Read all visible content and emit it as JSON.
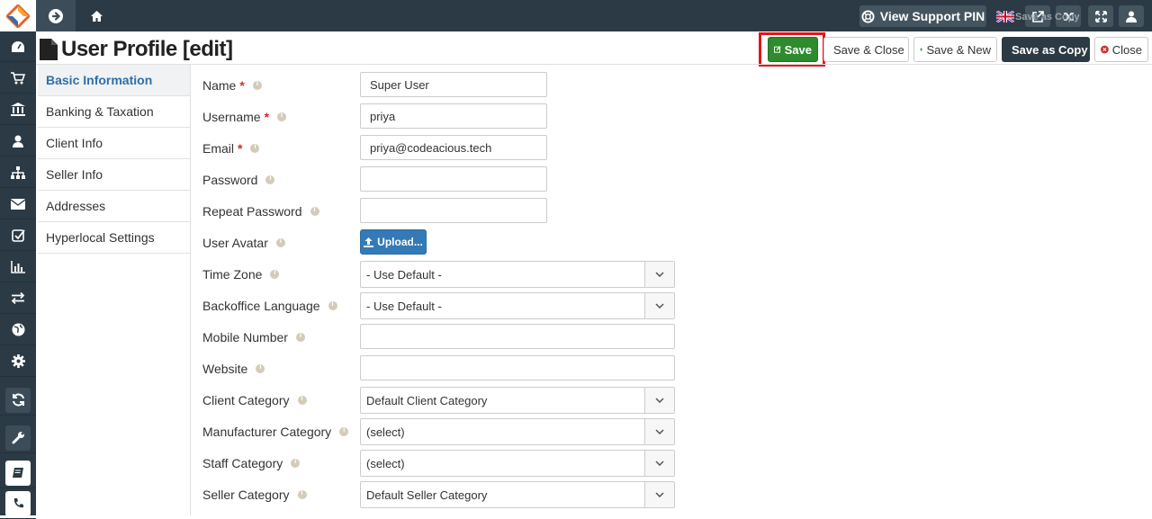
{
  "topbar": {
    "support_pin_label": "View Support PIN",
    "tooltip": "Save as Copy"
  },
  "page": {
    "title": "User Profile [edit]"
  },
  "toolbar": {
    "save_label": "Save",
    "save_close_label": "Save & Close",
    "save_new_label": "Save & New",
    "save_copy_label": "Save as Copy",
    "close_label": "Close"
  },
  "tabs": [
    {
      "label": "Basic Information"
    },
    {
      "label": "Banking & Taxation"
    },
    {
      "label": "Client Info"
    },
    {
      "label": "Seller Info"
    },
    {
      "label": "Addresses"
    },
    {
      "label": "Hyperlocal Settings"
    }
  ],
  "form": {
    "name": {
      "label": "Name",
      "value": "Super User"
    },
    "username": {
      "label": "Username",
      "value": "priya"
    },
    "email": {
      "label": "Email",
      "value": "priya@codeacious.tech"
    },
    "password": {
      "label": "Password",
      "value": ""
    },
    "repeat_password": {
      "label": "Repeat Password",
      "value": ""
    },
    "avatar": {
      "label": "User Avatar",
      "button": "Upload..."
    },
    "timezone": {
      "label": "Time Zone",
      "value": "- Use Default -"
    },
    "language": {
      "label": "Backoffice Language",
      "value": "- Use Default -"
    },
    "mobile": {
      "label": "Mobile Number",
      "value": ""
    },
    "website": {
      "label": "Website",
      "value": ""
    },
    "client_category": {
      "label": "Client Category",
      "value": "Default Client Category"
    },
    "manufacturer_category": {
      "label": "Manufacturer Category",
      "value": "(select)"
    },
    "staff_category": {
      "label": "Staff Category",
      "value": "(select)"
    },
    "seller_category": {
      "label": "Seller Category",
      "value": "Default Seller Category"
    }
  },
  "colors": {
    "topbar": "#2b3a45",
    "save": "#2e8b2e",
    "highlight": "#e3151a",
    "active_tab": "#2f6fa8",
    "upload": "#337ab7"
  }
}
